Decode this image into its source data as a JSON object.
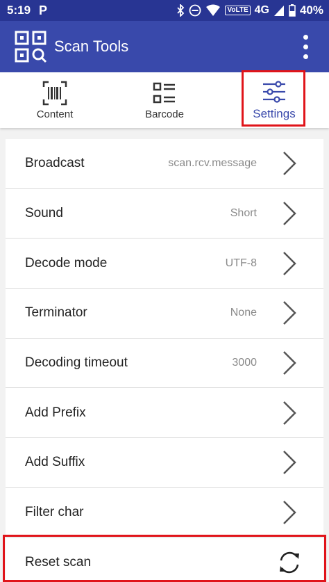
{
  "status_bar": {
    "time": "5:19",
    "network": "4G",
    "volte": "VoLTE",
    "battery": "40%"
  },
  "app_bar": {
    "title": "Scan Tools"
  },
  "tabs": [
    {
      "label": "Content",
      "icon": "barcode-scan-icon"
    },
    {
      "label": "Barcode",
      "icon": "list-icon"
    },
    {
      "label": "Settings",
      "icon": "sliders-icon",
      "active": true
    }
  ],
  "settings": [
    {
      "label": "Broadcast",
      "value": "scan.rcv.message"
    },
    {
      "label": "Sound",
      "value": "Short"
    },
    {
      "label": "Decode mode",
      "value": "UTF-8"
    },
    {
      "label": "Terminator",
      "value": "None"
    },
    {
      "label": "Decoding timeout",
      "value": "3000"
    },
    {
      "label": "Add Prefix",
      "value": ""
    },
    {
      "label": "Add Suffix",
      "value": ""
    },
    {
      "label": "Filter char",
      "value": ""
    },
    {
      "label": "Reset scan",
      "value": ""
    }
  ],
  "colors": {
    "status_bar": "#283593",
    "app_bar": "#3949ab",
    "accent": "#3949ab",
    "highlight": "#e0141a"
  }
}
